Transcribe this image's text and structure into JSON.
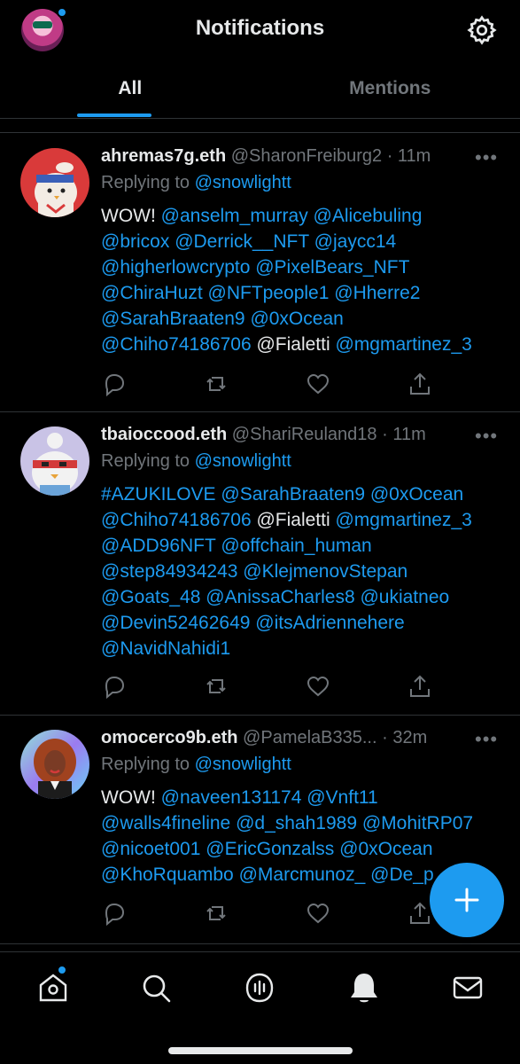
{
  "header": {
    "title": "Notifications",
    "tabs": [
      {
        "label": "All",
        "active": true
      },
      {
        "label": "Mentions",
        "active": false
      }
    ]
  },
  "colors": {
    "accent": "#1d9bf0",
    "muted": "#71767b",
    "text": "#e7e9ea",
    "background": "#000000"
  },
  "tweets": [
    {
      "name": "ahremas7g.eth",
      "handle": "@SharonFreiburg2",
      "separator": "·",
      "time": "11m",
      "more": "•••",
      "replying_prefix": "Replying to",
      "replying_to": "@snowlightt",
      "lines": [
        [
          {
            "t": "WOW! ",
            "m": false
          },
          {
            "t": "@anselm_murray",
            "m": true
          },
          {
            "t": " ",
            "m": false
          },
          {
            "t": "@Alicebuling",
            "m": true
          }
        ],
        [
          {
            "t": "@bricox",
            "m": true
          },
          {
            "t": " ",
            "m": false
          },
          {
            "t": "@Derrick__NFT",
            "m": true
          },
          {
            "t": " ",
            "m": false
          },
          {
            "t": "@jaycc14",
            "m": true
          }
        ],
        [
          {
            "t": "@higherlowcrypto",
            "m": true
          },
          {
            "t": " ",
            "m": false
          },
          {
            "t": "@PixelBears_NFT",
            "m": true
          }
        ],
        [
          {
            "t": "@ChiraHuzt",
            "m": true
          },
          {
            "t": " ",
            "m": false
          },
          {
            "t": "@NFTpeople1",
            "m": true
          },
          {
            "t": " ",
            "m": false
          },
          {
            "t": "@Hherre2",
            "m": true
          }
        ],
        [
          {
            "t": "@SarahBraaten9",
            "m": true
          },
          {
            "t": " ",
            "m": false
          },
          {
            "t": "@0xOcean",
            "m": true
          }
        ],
        [
          {
            "t": "@Chiho74186706",
            "m": true
          },
          {
            "t": " @Fialetti ",
            "m": false
          },
          {
            "t": "@mgmartinez_3",
            "m": true
          }
        ]
      ]
    },
    {
      "name": "tbaioccood.eth",
      "handle": "@ShariReuland18",
      "separator": "·",
      "time": "11m",
      "more": "•••",
      "replying_prefix": "Replying to",
      "replying_to": "@snowlightt",
      "lines": [
        [
          {
            "t": "#AZUKILOVE",
            "m": true
          },
          {
            "t": " ",
            "m": false
          },
          {
            "t": "@SarahBraaten9",
            "m": true
          },
          {
            "t": " ",
            "m": false
          },
          {
            "t": "@0xOcean",
            "m": true
          }
        ],
        [
          {
            "t": "@Chiho74186706",
            "m": true
          },
          {
            "t": " @Fialetti ",
            "m": false
          },
          {
            "t": "@mgmartinez_3",
            "m": true
          }
        ],
        [
          {
            "t": "@ADD96NFT",
            "m": true
          },
          {
            "t": " ",
            "m": false
          },
          {
            "t": "@offchain_human",
            "m": true
          }
        ],
        [
          {
            "t": "@step84934243",
            "m": true
          },
          {
            "t": " ",
            "m": false
          },
          {
            "t": "@KlejmenovStepan",
            "m": true
          }
        ],
        [
          {
            "t": "@Goats_48",
            "m": true
          },
          {
            "t": " ",
            "m": false
          },
          {
            "t": "@AnissaCharles8",
            "m": true
          },
          {
            "t": " ",
            "m": false
          },
          {
            "t": "@ukiatneo",
            "m": true
          }
        ],
        [
          {
            "t": "@Devin52462649",
            "m": true
          },
          {
            "t": " ",
            "m": false
          },
          {
            "t": "@itsAdriennehere",
            "m": true
          }
        ],
        [
          {
            "t": "@NavidNahidi1",
            "m": true
          }
        ]
      ]
    },
    {
      "name": "omocerco9b.eth",
      "handle": "@PamelaB335...",
      "separator": "·",
      "time": "32m",
      "more": "•••",
      "replying_prefix": "Replying to",
      "replying_to": "@snowlightt",
      "lines": [
        [
          {
            "t": "WOW! ",
            "m": false
          },
          {
            "t": "@naveen131174",
            "m": true
          },
          {
            "t": " ",
            "m": false
          },
          {
            "t": "@Vnft11",
            "m": true
          }
        ],
        [
          {
            "t": "@walls4fineline",
            "m": true
          },
          {
            "t": " ",
            "m": false
          },
          {
            "t": "@d_shah1989",
            "m": true
          },
          {
            "t": " ",
            "m": false
          },
          {
            "t": "@MohitRP07",
            "m": true
          }
        ],
        [
          {
            "t": "@nicoet001",
            "m": true
          },
          {
            "t": " ",
            "m": false
          },
          {
            "t": "@EricGonzalss",
            "m": true
          },
          {
            "t": " ",
            "m": false
          },
          {
            "t": "@0xOcean",
            "m": true
          }
        ],
        [
          {
            "t": "@KhoRquambo",
            "m": true
          },
          {
            "t": " ",
            "m": false
          },
          {
            "t": "@Marcmunoz_",
            "m": true
          },
          {
            "t": " ",
            "m": false
          },
          {
            "t": "@De_p",
            "m": true
          }
        ]
      ]
    }
  ],
  "icons": {
    "settings": "gear-icon",
    "reply": "reply-icon",
    "retweet": "retweet-icon",
    "like": "heart-icon",
    "share": "share-icon",
    "compose": "plus-icon",
    "nav": [
      "home-icon",
      "search-icon",
      "spaces-icon",
      "notifications-icon",
      "messages-icon"
    ]
  }
}
